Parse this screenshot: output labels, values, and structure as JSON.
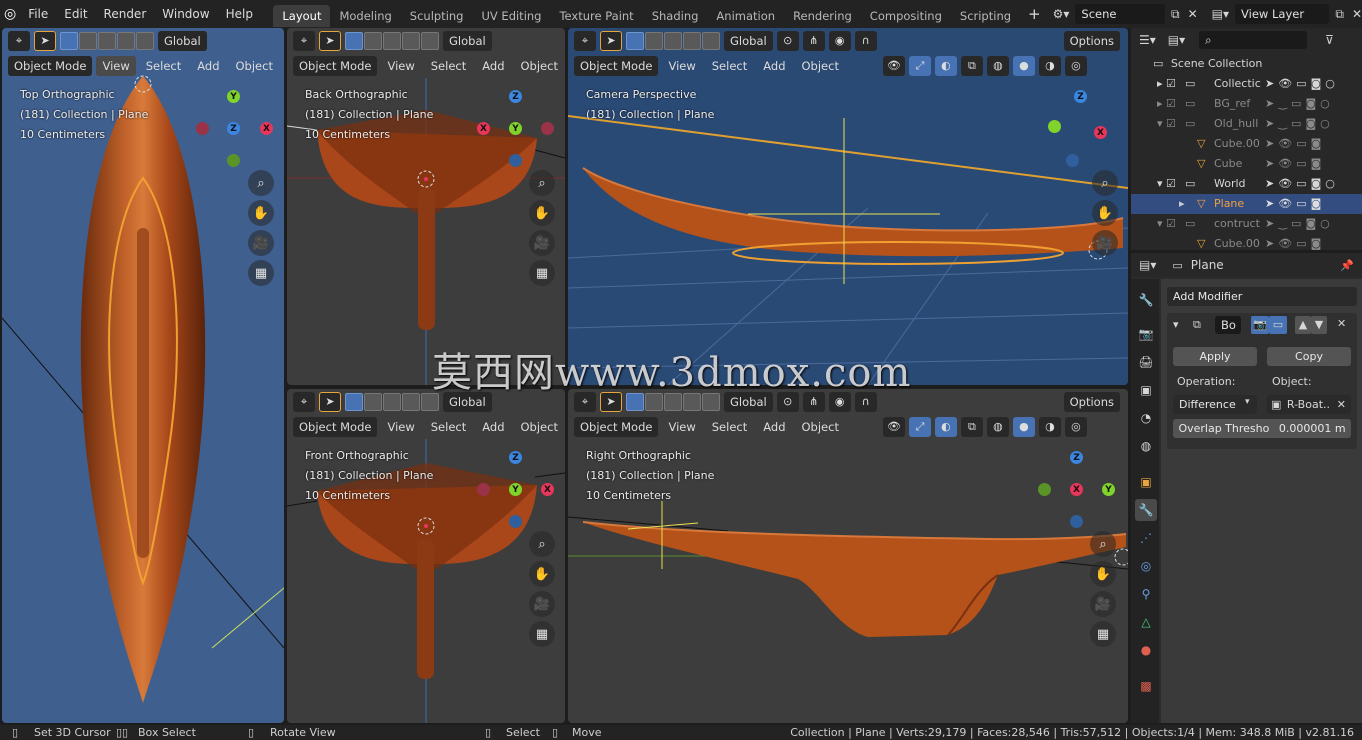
{
  "menubar": {
    "items": [
      "File",
      "Edit",
      "Render",
      "Window",
      "Help"
    ],
    "workspaces": [
      "Layout",
      "Modeling",
      "Sculpting",
      "UV Editing",
      "Texture Paint",
      "Shading",
      "Animation",
      "Rendering",
      "Compositing",
      "Scripting"
    ],
    "active_workspace": "Layout",
    "add_tab": "+",
    "scene_label": "Scene",
    "view_layer_label": "View Layer"
  },
  "viewport_common": {
    "orientation": "Global",
    "mode": "Object Mode",
    "view_menu": "View",
    "select_menu": "Select",
    "add_menu": "Add",
    "object_menu": "Object",
    "options": "Options",
    "collection_line": "(181) Collection | Plane",
    "scale_line": "10 Centimeters"
  },
  "viewports": {
    "top": {
      "title": "Top Orthographic"
    },
    "back": {
      "title": "Back Orthographic"
    },
    "camera": {
      "title": "Camera Perspective"
    },
    "front": {
      "title": "Front Orthographic"
    },
    "right": {
      "title": "Right Orthographic"
    }
  },
  "watermark": "莫西网www.3dmox.com",
  "outliner": {
    "header": "Scene Collection",
    "rows": [
      {
        "label": "Collectic",
        "selected": false
      },
      {
        "label": "BG_ref",
        "selected": false
      },
      {
        "label": "Old_hull",
        "selected": false
      },
      {
        "label": "Cube.00",
        "selected": false
      },
      {
        "label": "Cube",
        "selected": false
      },
      {
        "label": "World",
        "selected": false
      },
      {
        "label": "Plane",
        "selected": true
      },
      {
        "label": "contruct",
        "selected": false
      },
      {
        "label": "Cube.00",
        "selected": false
      }
    ]
  },
  "properties": {
    "object_name": "Plane",
    "add_modifier": "Add Modifier",
    "modifier_name": "Bo",
    "apply": "Apply",
    "copy": "Copy",
    "operation_label": "Operation:",
    "object_label": "Object:",
    "operation_value": "Difference",
    "object_value": "R-Boat..",
    "overlap_label": "Overlap Thresho",
    "overlap_value": "0.000001 m"
  },
  "statusbar": {
    "set_cursor": "Set 3D Cursor",
    "box_select": "Box Select",
    "rotate_view": "Rotate View",
    "select": "Select",
    "move": "Move",
    "stats": "Collection | Plane | Verts:29,179 | Faces:28,546 | Tris:57,512 | Objects:1/4 | Mem: 348.8 MiB | v2.81.16"
  },
  "colors": {
    "hull": "#b5521a",
    "selection_outline": "#f0a030",
    "axis_x": "#e8365b",
    "axis_y": "#7fd32a",
    "axis_z": "#3b86e0",
    "selected_row": "#334d80",
    "active_tab": "#3d3d3d"
  }
}
